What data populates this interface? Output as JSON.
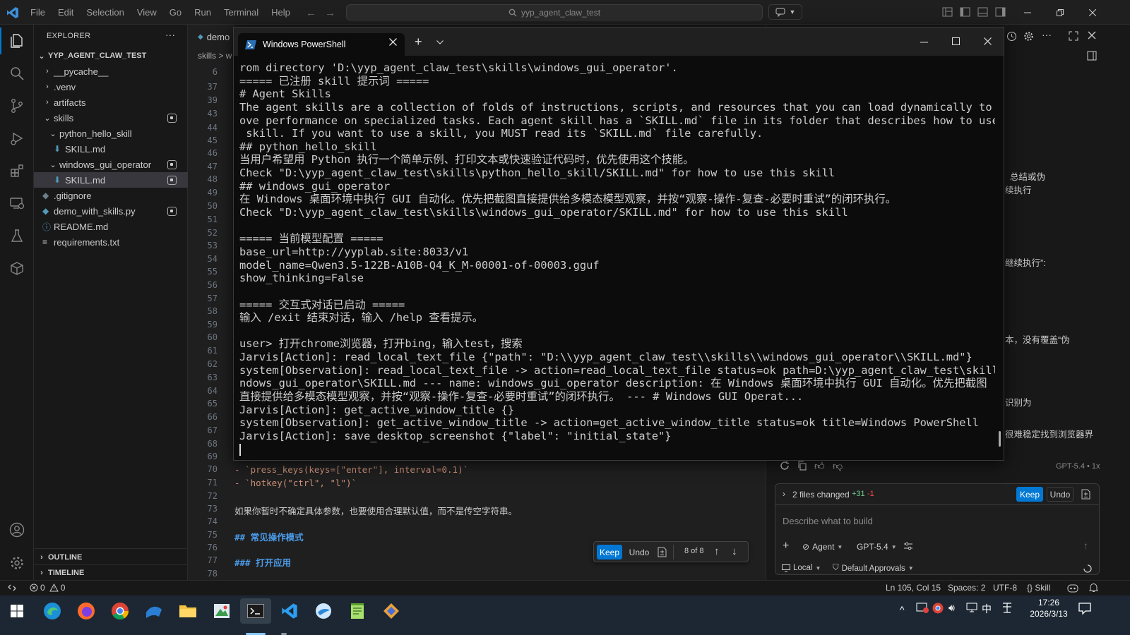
{
  "menu": [
    "File",
    "Edit",
    "Selection",
    "View",
    "Go",
    "Run",
    "Terminal",
    "Help"
  ],
  "command_center": {
    "text": "yyp_agent_claw_test"
  },
  "explorer": {
    "title": "EXPLORER",
    "more": "···",
    "root": "YYP_AGENT_CLAW_TEST",
    "items": [
      {
        "label": "__pycache__",
        "type": "folder-collapsed"
      },
      {
        "label": ".venv",
        "type": "folder-collapsed"
      },
      {
        "label": "artifacts",
        "type": "folder-collapsed"
      },
      {
        "label": "skills",
        "type": "folder-expanded"
      },
      {
        "label": "python_hello_skill",
        "type": "folder-expanded"
      },
      {
        "label": "SKILL.md",
        "type": "md"
      },
      {
        "label": "windows_gui_operator",
        "type": "folder-expanded"
      },
      {
        "label": "SKILL.md",
        "type": "md"
      },
      {
        "label": ".gitignore",
        "type": "file"
      },
      {
        "label": "demo_with_skills.py",
        "type": "py"
      },
      {
        "label": "README.md",
        "type": "info"
      },
      {
        "label": "requirements.txt",
        "type": "txt"
      }
    ],
    "outline": "OUTLINE",
    "timeline": "TIMELINE"
  },
  "editor": {
    "tab_label": "demo",
    "breadcrumb": "skills > w",
    "line_numbers": [
      "6",
      "37",
      "39",
      "43",
      "44",
      "45",
      "46",
      "47",
      "48",
      "49",
      "50",
      "51",
      "52",
      "53",
      "54",
      "55",
      "56",
      "57",
      "58",
      "59",
      "60",
      "61",
      "62",
      "63",
      "64",
      "65",
      "66",
      "67",
      "68",
      "69",
      "70",
      "71",
      "72",
      "73",
      "74",
      "75",
      "76",
      "77",
      "78"
    ],
    "visible_code": [
      {
        "line": "70",
        "text": "- `press_keys(keys=[\"enter\"], interval=0.1)`",
        "style": "code"
      },
      {
        "line": "71",
        "text": "- `hotkey(\"ctrl\", \"l\")`",
        "style": "code"
      },
      {
        "line": "72",
        "text": "",
        "style": "plain"
      },
      {
        "line": "73",
        "text": "如果你暂时不确定具体参数，也要使用合理默认值，而不是传空字符串。",
        "style": "plain"
      },
      {
        "line": "74",
        "text": "",
        "style": "plain"
      },
      {
        "line": "75",
        "text": "## 常见操作模式",
        "style": "heading"
      },
      {
        "line": "76",
        "text": "",
        "style": "plain"
      },
      {
        "line": "77",
        "text": "### 打开应用",
        "style": "heading"
      },
      {
        "line": "78",
        "text": "",
        "style": "plain"
      }
    ],
    "diff_toolbar": {
      "keep": "Keep",
      "undo": "Undo",
      "counter": "8 of 8"
    }
  },
  "powershell": {
    "tab_title": "Windows PowerShell",
    "lines": [
      "rom directory 'D:\\yyp_agent_claw_test\\skills\\windows_gui_operator'.",
      "===== 已注册 skill 提示词 =====",
      "# Agent Skills",
      "The agent skills are a collection of folds of instructions, scripts, and resources that you can load dynamically to impr",
      "ove performance on specialized tasks. Each agent skill has a `SKILL.md` file in its folder that describes how to use the",
      " skill. If you want to use a skill, you MUST read its `SKILL.md` file carefully.",
      "## python_hello_skill",
      "当用户希望用 Python 执行一个简单示例、打印文本或快速验证代码时，优先使用这个技能。",
      "Check \"D:\\yyp_agent_claw_test\\skills\\python_hello_skill/SKILL.md\" for how to use this skill",
      "## windows_gui_operator",
      "在 Windows 桌面环境中执行 GUI 自动化。优先把截图直接提供给多模态模型观察，并按“观察-操作-复查-必要时重试”的闭环执行。",
      "Check \"D:\\yyp_agent_claw_test\\skills\\windows_gui_operator/SKILL.md\" for how to use this skill",
      "",
      "===== 当前模型配置 =====",
      "base_url=http://yyplab.site:8033/v1",
      "model_name=Qwen3.5-122B-A10B-Q4_K_M-00001-of-00003.gguf",
      "show_thinking=False",
      "",
      "===== 交互式对话已启动 =====",
      "输入 /exit 结束对话，输入 /help 查看提示。",
      "",
      "user> 打开chrome浏览器，打开bing，输入test，搜索",
      "Jarvis[Action]: read_local_text_file {\"path\": \"D:\\\\yyp_agent_claw_test\\\\skills\\\\windows_gui_operator\\\\SKILL.md\"}",
      "system[Observation]: read_local_text_file -> action=read_local_text_file status=ok path=D:\\yyp_agent_claw_test\\skills\\wi",
      "ndows_gui_operator\\SKILL.md --- name: windows_gui_operator description: 在 Windows 桌面环境中执行 GUI 自动化。优先把截图",
      "直接提供给多模态模型观察，并按“观察-操作-复查-必要时重试”的闭环执行。 --- # Windows GUI Operat...",
      "Jarvis[Action]: get_active_window_title {}",
      "system[Observation]: get_active_window_title -> action=get_active_window_title status=ok title=Windows PowerShell",
      "Jarvis[Action]: save_desktop_screenshot {\"label\": \"initial_state\"}"
    ]
  },
  "chat": {
    "fragments": [
      "总结或伪",
      "续执行",
      "继续执行”:",
      "本，没有覆盖“伪",
      "识别为",
      "很难稳定找到浏览器界"
    ],
    "model_badge": "GPT-5.4 • 1x",
    "files_changed": {
      "label": "2 files changed",
      "added": "+31",
      "removed": "-1",
      "keep": "Keep",
      "undo": "Undo"
    },
    "input_placeholder": "Describe what to build",
    "agent_label": "Agent",
    "model_label": "GPT-5.4",
    "local_label": "Local",
    "approvals_label": "Default Approvals"
  },
  "statusbar": {
    "errors": "0",
    "warnings": "0",
    "cursor": "Ln 105, Col 15",
    "spaces": "Spaces: 2",
    "encoding": "UTF-8",
    "language": "{} Skill"
  },
  "taskbar": {
    "ime": "中",
    "time": "17:26",
    "date": "2026/3/13"
  },
  "colors": {
    "accent": "#0078d4",
    "added": "#73c991",
    "removed": "#f14c4c",
    "heading": "#d7ba7d",
    "code_orange": "#ce9178"
  }
}
